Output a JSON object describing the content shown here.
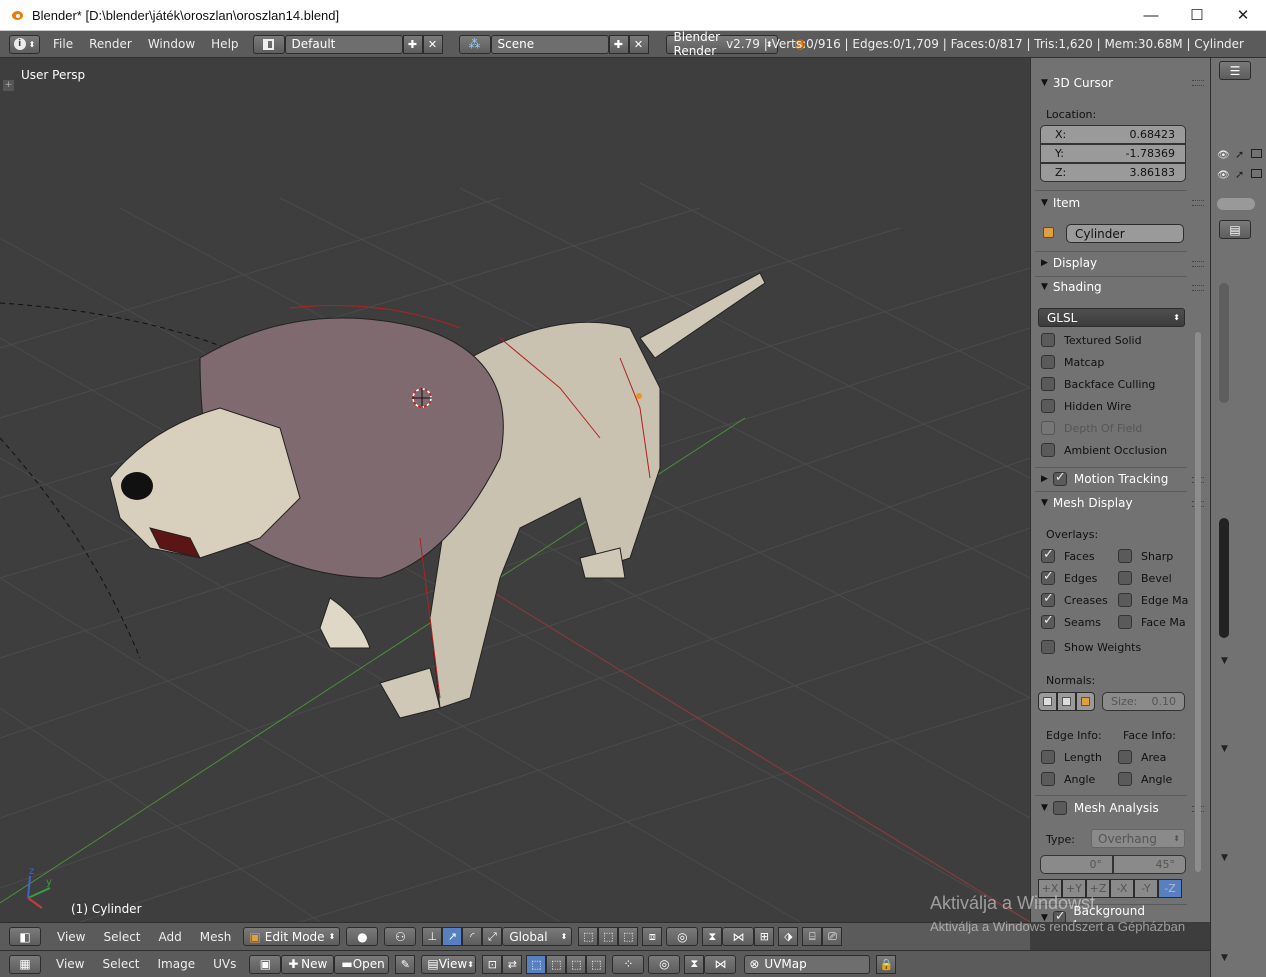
{
  "window": {
    "title": "Blender* [D:\\blender\\játék\\oroszlan\\oroszlan14.blend]",
    "minimize": "—",
    "maximize": "☐",
    "close": "✕"
  },
  "menubar": {
    "items": [
      "File",
      "Render",
      "Window",
      "Help"
    ],
    "screen_layout": "Default",
    "scene": "Scene",
    "render_engine": "Blender Render",
    "stats": "v2.79 | Verts:0/916 | Edges:0/1,709 | Faces:0/817 | Tris:1,620 | Mem:30.68M | Cylinder"
  },
  "viewport": {
    "view_label": "User Persp",
    "object_label": "(1) Cylinder"
  },
  "properties": {
    "cursor": {
      "title": "3D Cursor",
      "location_label": "Location:",
      "x_label": "X:",
      "x": "0.68423",
      "y_label": "Y:",
      "y": "-1.78369",
      "z_label": "Z:",
      "z": "3.86183"
    },
    "item": {
      "title": "Item",
      "name": "Cylinder"
    },
    "display": {
      "title": "Display"
    },
    "shading": {
      "title": "Shading",
      "mode": "GLSL",
      "textured_solid": "Textured Solid",
      "matcap": "Matcap",
      "backface_culling": "Backface Culling",
      "hidden_wire": "Hidden Wire",
      "depth_of_field": "Depth Of Field",
      "ambient_occlusion": "Ambient Occlusion"
    },
    "motion_tracking": {
      "title": "Motion Tracking",
      "checked": true
    },
    "mesh_display": {
      "title": "Mesh Display",
      "overlays_label": "Overlays:",
      "faces": "Faces",
      "edges": "Edges",
      "creases": "Creases",
      "seams": "Seams",
      "sharp": "Sharp",
      "bevel": "Bevel",
      "edge_marks": "Edge Ma",
      "face_marks": "Face Ma",
      "show_weights": "Show Weights",
      "normals_label": "Normals:",
      "size_label": "Size:",
      "size": "0.10",
      "edge_info_label": "Edge Info:",
      "face_info_label": "Face Info:",
      "edge_length": "Length",
      "edge_angle": "Angle",
      "face_area": "Area",
      "face_angle": "Angle"
    },
    "mesh_analysis": {
      "title": "Mesh Analysis",
      "type_label": "Type:",
      "type": "Overhang",
      "min": "0°",
      "max": "45°",
      "axes": [
        "+X",
        "+Y",
        "+Z",
        "-X",
        "-Y",
        "-Z"
      ]
    },
    "background_images": {
      "title": "Background Images"
    }
  },
  "view3d_header": {
    "menus": [
      "View",
      "Select",
      "Add",
      "Mesh"
    ],
    "mode": "Edit Mode",
    "orientation": "Global"
  },
  "uv_header": {
    "menus": [
      "View",
      "Select",
      "Image",
      "UVs"
    ],
    "new": "New",
    "open": "Open",
    "view": "View",
    "uvmap": "UVMap"
  },
  "watermark": {
    "line1": "Aktiválja a Windowst",
    "line2": "Aktiválja a Windows rendszert a Gépházban"
  }
}
